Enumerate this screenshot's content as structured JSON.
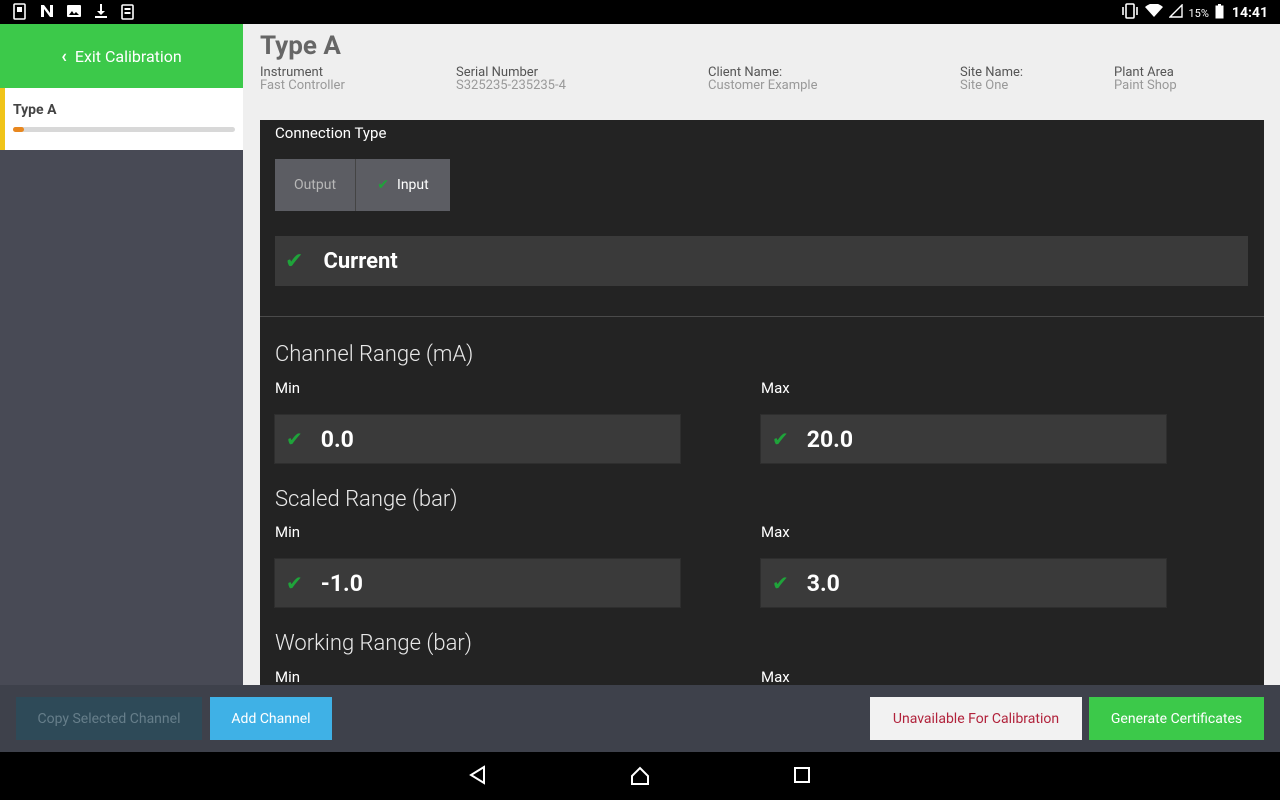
{
  "status_bar": {
    "battery_percent": "15%",
    "time": "14:41",
    "left_icons": [
      "sim-icon",
      "n-icon",
      "image-icon",
      "download-icon",
      "clipboard-icon"
    ],
    "right_icons": [
      "vibrate-icon",
      "wifi-icon",
      "signal-icon",
      "battery-icon"
    ]
  },
  "sidebar": {
    "exit_label": "Exit Calibration",
    "channel": {
      "label": "Type A",
      "progress": 0.05
    },
    "colors": {
      "exit_bg": "#3cc94a",
      "indicator": "#f0c419",
      "progress": "#e8871e"
    }
  },
  "header": {
    "title": "Type A",
    "fields": [
      {
        "key": "Instrument",
        "value": "Fast Controller"
      },
      {
        "key": "Serial Number",
        "value": "S325235-235235-4"
      },
      {
        "key": "Client Name:",
        "value": "Customer Example"
      },
      {
        "key": "Site Name:",
        "value": "Site One"
      },
      {
        "key": "Plant Area",
        "value": "Paint Shop"
      }
    ]
  },
  "connection": {
    "title": "Connection Type",
    "options": [
      "Output",
      "Input"
    ],
    "selected": "Input",
    "signal_type": "Current"
  },
  "ranges": {
    "channel": {
      "title": "Channel Range (mA)",
      "min_label": "Min",
      "max_label": "Max",
      "min": "0.0",
      "max": "20.0"
    },
    "scaled": {
      "title": "Scaled Range (bar)",
      "min_label": "Min",
      "max_label": "Max",
      "min": "-1.0",
      "max": "3.0"
    },
    "working": {
      "title": "Working Range (bar)",
      "min_label": "Min",
      "max_label": "Max"
    }
  },
  "actions": {
    "copy": "Copy Selected Channel",
    "add": "Add Channel",
    "unavailable": "Unavailable For Calibration",
    "generate": "Generate Certificates"
  },
  "nav": {
    "back": "back-icon",
    "home": "home-icon",
    "recents": "recents-icon"
  }
}
